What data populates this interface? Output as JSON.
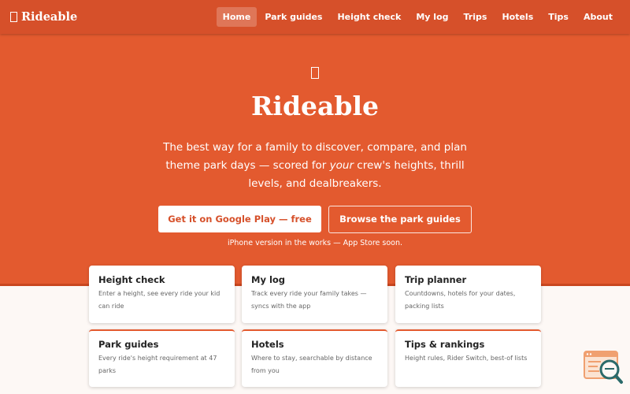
{
  "brand": {
    "name": "Rideable"
  },
  "nav": {
    "links": [
      {
        "label": "Home",
        "active": true
      },
      {
        "label": "Park guides"
      },
      {
        "label": "Height check"
      },
      {
        "label": "My log"
      },
      {
        "label": "Trips"
      },
      {
        "label": "Hotels"
      },
      {
        "label": "Tips"
      },
      {
        "label": "About"
      }
    ]
  },
  "hero": {
    "title": "Rideable",
    "subtitle_before": "The best way for a family to discover, compare, and plan theme park days — scored for ",
    "subtitle_em": "your",
    "subtitle_after": " crew's heights, thrill levels, and dealbreakers.",
    "primary_button": "Get it on Google Play — free",
    "secondary_button": "Browse the park guides",
    "note": "iPhone version in the works — App Store soon."
  },
  "cards": [
    {
      "title": "Height check",
      "desc": "Enter a height, see every ride your kid can ride"
    },
    {
      "title": "My log",
      "desc": "Track every ride your family takes — syncs with the app"
    },
    {
      "title": "Trip planner",
      "desc": "Countdowns, hotels for your dates, packing lists"
    },
    {
      "title": "Park guides",
      "desc": "Every ride's height requirement at 47 parks"
    },
    {
      "title": "Hotels",
      "desc": "Where to stay, searchable by distance from you"
    },
    {
      "title": "Tips & rankings",
      "desc": "Height rules, Rider Switch, best-of lists"
    }
  ],
  "colors": {
    "brand_orange": "#e35a2f",
    "nav_orange": "#d6502a",
    "page_background": "#fdf8f5",
    "widget_orange": "#f0a070",
    "widget_teal": "#2a6a6a"
  },
  "icons": {
    "brand": "card-outline-icon",
    "hero": "card-outline-icon",
    "widget": "search-magnifier-icon"
  }
}
